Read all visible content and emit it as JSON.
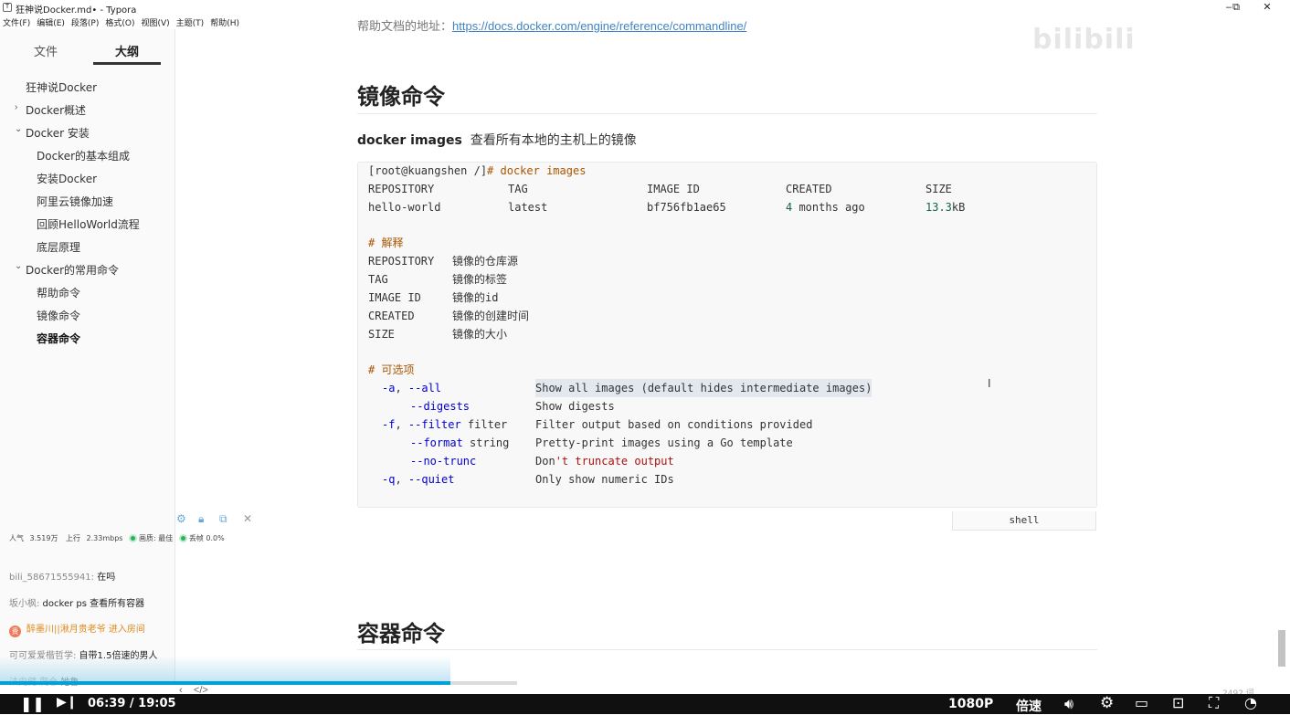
{
  "window": {
    "title": "狂神说Docker.md• - Typora",
    "controls": {
      "minimize": "–",
      "restore": "⧉",
      "close": "✕"
    }
  },
  "menu": [
    "文件(F)",
    "编辑(E)",
    "段落(P)",
    "格式(O)",
    "视图(V)",
    "主题(T)",
    "帮助(H)"
  ],
  "sidebar": {
    "tabs": [
      "文件",
      "大纲"
    ],
    "active_tab": "大纲",
    "outline": [
      {
        "label": "狂神说Docker",
        "expander": ""
      },
      {
        "label": "Docker概述",
        "expander": "›"
      },
      {
        "label": "Docker 安装",
        "expander": "⌄"
      },
      {
        "label": "Docker的基本组成",
        "expander": ""
      },
      {
        "label": "安装Docker",
        "expander": ""
      },
      {
        "label": "阿里云镜像加速",
        "expander": ""
      },
      {
        "label": "回顾HelloWorld流程",
        "expander": ""
      },
      {
        "label": "底层原理",
        "expander": ""
      },
      {
        "label": "Docker的常用命令",
        "expander": "⌄"
      },
      {
        "label": "帮助命令",
        "expander": ""
      },
      {
        "label": "镜像命令",
        "expander": ""
      },
      {
        "label": "容器命令",
        "expander": ""
      }
    ]
  },
  "live": {
    "stats": {
      "popularity_label": "人气",
      "popularity": "3.519万",
      "upload_label": "上行",
      "upload": "2.33mbps",
      "quality_label": "画质: 最佳",
      "drop_label": "丢帧 0.0%"
    },
    "chat": [
      {
        "user": "bili_58671555941:",
        "text": " 在吗"
      },
      {
        "user": "坂小枫:",
        "text": " docker ps 查看所有容器"
      },
      {
        "user": "",
        "text": "醉墨川||湫月贵老爷 进入房间"
      },
      {
        "user": "可可爱爱楷哲学:",
        "text": " 自带1.5倍速的男人"
      },
      {
        "user": "法史健 爬仓",
        "text": " 她鲁"
      }
    ],
    "sys_badge": "贵"
  },
  "doc": {
    "top_link_prefix": "帮助文档的地址：",
    "top_link": "https://docs.docker.com/engine/reference/commandline/",
    "h_images": "镜像命令",
    "cmd_name": "docker images",
    "cmd_desc": "查看所有本地的主机上的镜像",
    "code": {
      "prompt": "[root@kuangshen /]",
      "command": "# docker images",
      "header": [
        "REPOSITORY",
        "TAG",
        "IMAGE ID",
        "CREATED",
        "SIZE"
      ],
      "row": {
        "repo": "hello-world",
        "tag": "latest",
        "image_id": "bf756fb1ae65",
        "created_num": "4",
        "created_text": " months ago",
        "size_num": "13.3",
        "size_unit": "kB"
      },
      "explain_title": "# 解释",
      "explain": [
        {
          "key": "REPOSITORY",
          "desc": "镜像的仓库源"
        },
        {
          "key": "TAG",
          "desc": "镜像的标签"
        },
        {
          "key": "IMAGE ID",
          "desc": "镜像的id"
        },
        {
          "key": "CREATED",
          "desc": "镜像的创建时间"
        },
        {
          "key": "SIZE",
          "desc": "镜像的大小"
        }
      ],
      "options_title": "# 可选项",
      "options": {
        "a_short": "-a",
        "a_long": "--all",
        "a_desc": "Show all images (default hides intermediate images)",
        "digests": "--digests",
        "digests_desc": "Show digests",
        "f_short": "-f",
        "f_long": "--filter",
        "f_arg": " filter",
        "f_desc": "Filter output based on conditions provided",
        "format": "--format",
        "format_arg": " string",
        "format_desc": "Pretty-print images using a Go template",
        "notrunc": "--no-trunc",
        "notrunc_desc_a": "Don",
        "notrunc_desc_b": "'t truncate output",
        "q_short": "-q",
        "q_long": "--quiet",
        "q_desc": "Only show numeric IDs"
      },
      "language": "shell"
    },
    "h_containers": "容器命令",
    "word_count": "2492 词"
  },
  "player": {
    "time": "06:39 / 19:05",
    "progress_fraction": 0.349,
    "quality": "1080P",
    "speed_label": "倍速"
  },
  "watermark": "bilibili",
  "colors": {
    "progress": "#00a1d6",
    "link": "#4183c4",
    "code_comment": "#aa5500",
    "code_keyword": "#0000cc"
  }
}
